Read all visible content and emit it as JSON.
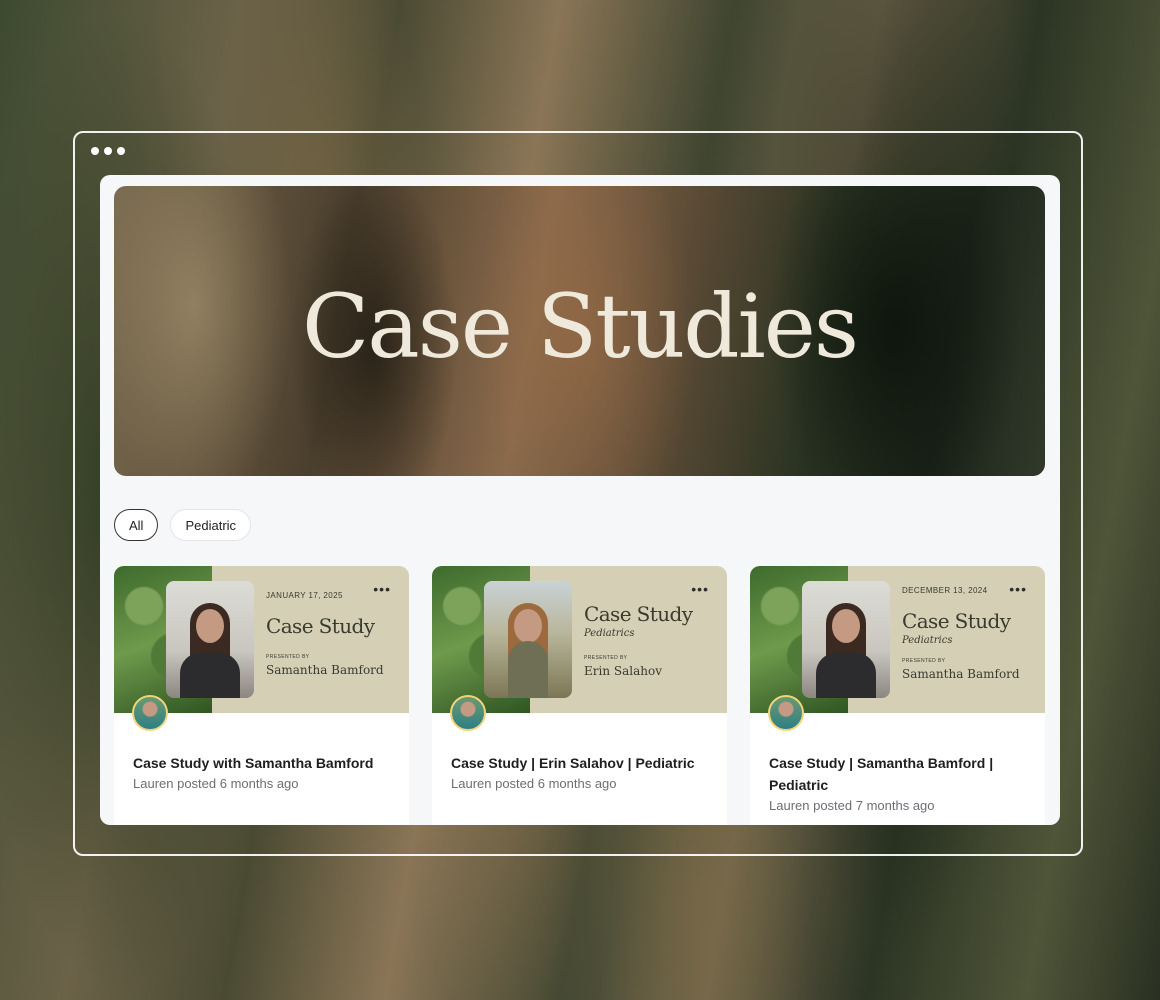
{
  "hero": {
    "title": "Case Studies"
  },
  "filters": [
    {
      "label": "All",
      "active": true
    },
    {
      "label": "Pediatric",
      "active": false
    }
  ],
  "cards": [
    {
      "thumb": {
        "date": "JANUARY 17, 2025",
        "heading": "Case Study",
        "subheading": "",
        "presented_by": "PRESENTED BY",
        "presenter": "Samantha Bamford"
      },
      "title": "Case Study with Samantha Bamford",
      "meta": "Lauren posted 6 months ago"
    },
    {
      "thumb": {
        "date": "",
        "heading": "Case Study",
        "subheading": "Pediatrics",
        "presented_by": "PRESENTED BY",
        "presenter": "Erin Salahov"
      },
      "title": "Case Study | Erin Salahov | Pediatric",
      "meta": "Lauren posted 6 months ago"
    },
    {
      "thumb": {
        "date": "DECEMBER 13, 2024",
        "heading": "Case Study",
        "subheading": "Pediatrics",
        "presented_by": "PRESENTED BY",
        "presenter": "Samantha Bamford"
      },
      "title": "Case Study | Samantha Bamford | Pediatric",
      "meta": "Lauren posted 7 months ago"
    }
  ]
}
